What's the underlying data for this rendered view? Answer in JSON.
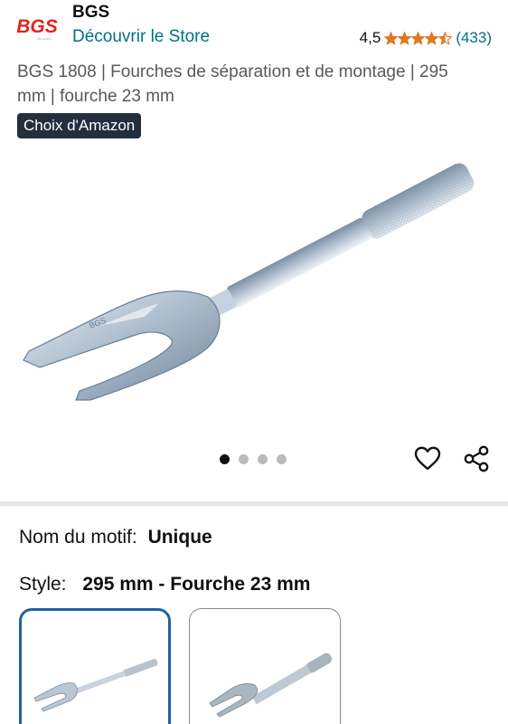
{
  "brand": {
    "name": "BGS",
    "logo_text": "BGS",
    "store_link": "Découvrir le Store"
  },
  "rating": {
    "value": "4,5",
    "stars": 4.5,
    "count": "(433)"
  },
  "product": {
    "title": "BGS 1808 | Fourches de séparation et de montage | 295 mm | fourche 23 mm",
    "badge": "Choix d'Amazon",
    "image_engraving": "BGS"
  },
  "gallery": {
    "image_count": 4,
    "active_index": 0
  },
  "actions": {
    "favorite_icon": "heart-icon",
    "share_icon": "share-icon"
  },
  "variants": {
    "motif_label": "Nom du motif:",
    "motif_value": "Unique",
    "style_label": "Style:",
    "style_value": "295 mm - Fourche 23 mm",
    "options": [
      {
        "name": "295 mm - Fourche 23 mm",
        "selected": true
      },
      {
        "name": "option-2",
        "selected": false
      }
    ]
  },
  "colors": {
    "link": "#007185",
    "star": "#de7921",
    "badge_bg": "#232f3e",
    "selected_border": "#2162a1",
    "logo_red": "#e2231a"
  }
}
